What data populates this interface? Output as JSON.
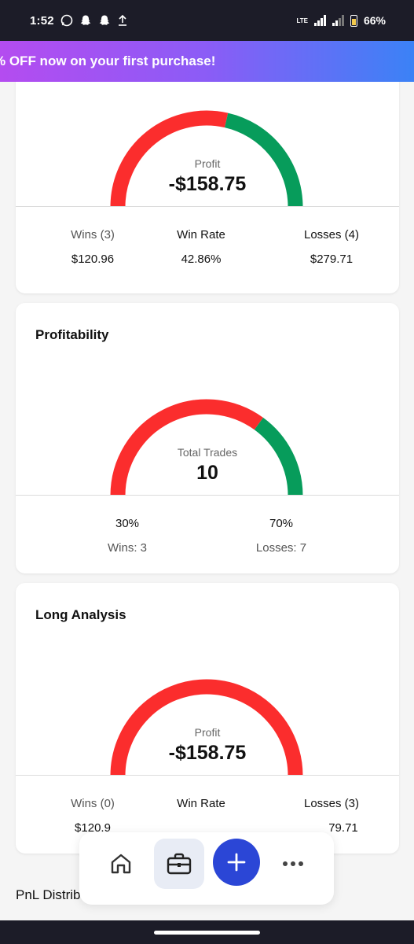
{
  "status_bar": {
    "time": "1:52",
    "network": "LTE",
    "battery_percent": "66%"
  },
  "promo": {
    "text": "% OFF now on your first purchase!"
  },
  "cards": {
    "top": {
      "gauge": {
        "label": "Profit",
        "value": "-$158.75",
        "win_fraction": 0.4286,
        "colors": {
          "loss": "#fb2d2d",
          "win": "#079c5b"
        }
      },
      "stats": {
        "wins_label": "Wins (3)",
        "wins_value": "$120.96",
        "rate_label": "Win Rate",
        "rate_value": "42.86%",
        "losses_label": "Losses (4)",
        "losses_value": "$279.71"
      }
    },
    "profitability": {
      "title": "Profitability",
      "gauge": {
        "label": "Total Trades",
        "value": "10",
        "win_fraction": 0.3
      },
      "stats": {
        "wins_pct": "30%",
        "wins_label": "Wins: 3",
        "losses_pct": "70%",
        "losses_label": "Losses: 7"
      }
    },
    "long_analysis": {
      "title": "Long Analysis",
      "gauge": {
        "label": "Profit",
        "value": "-$158.75",
        "win_fraction": 0
      },
      "stats": {
        "wins_label": "Wins (0)",
        "wins_value": "$120.9",
        "rate_label": "Win Rate",
        "losses_label": "Losses (3)",
        "losses_value": "79.71"
      }
    }
  },
  "bottom_nav": {
    "items": [
      "home-icon",
      "briefcase-icon",
      "plus-icon",
      "more-icon"
    ],
    "active": "briefcase-icon",
    "accent": "#2b46d6"
  },
  "pnl_section": {
    "title": "PnL Distrib"
  }
}
